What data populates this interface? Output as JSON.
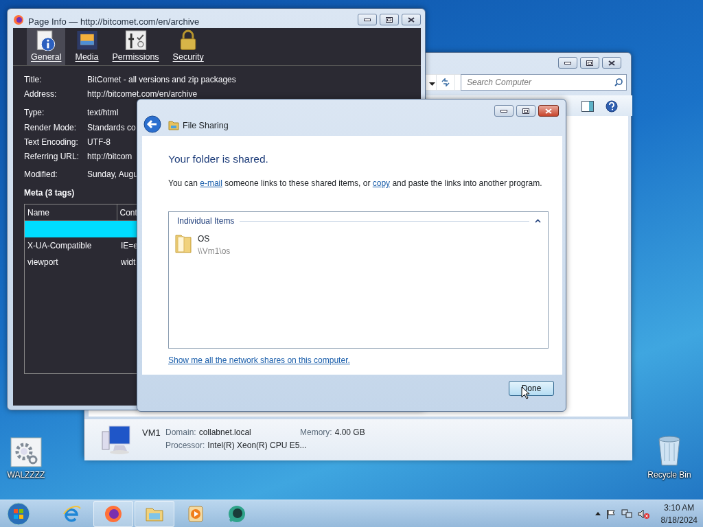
{
  "desktop_icons": [
    {
      "kind": "settings",
      "label": "WALZZZZ"
    },
    {
      "kind": "recycle",
      "label": "Recycle Bin"
    }
  ],
  "explorer_window": {
    "search": {
      "placeholder": "Search Computer"
    },
    "details": {
      "name": "VM1",
      "fields": [
        {
          "label": "Domain:",
          "value": "collabnet.local"
        },
        {
          "label": "Memory:",
          "value": "4.00 GB"
        },
        {
          "label": "Processor:",
          "value": "Intel(R) Xeon(R) CPU E5..."
        }
      ]
    }
  },
  "page_info_window": {
    "title": "Page Info — http://bitcomet.com/en/archive",
    "tabs": [
      {
        "kind": "general",
        "label": "General",
        "selected": true
      },
      {
        "kind": "media",
        "label": "Media",
        "selected": false
      },
      {
        "kind": "permissions",
        "label": "Permissions",
        "selected": false
      },
      {
        "kind": "security",
        "label": "Security",
        "selected": false
      }
    ],
    "fields": [
      {
        "label": "Title:",
        "value": "BitComet - all versions and zip packages"
      },
      {
        "label": "Address:",
        "value": "http://bitcomet.com/en/archive"
      },
      {
        "label": "Type:",
        "value": "text/html"
      },
      {
        "label": "Render Mode:",
        "value": "Standards co"
      },
      {
        "label": "Text Encoding:",
        "value": "UTF-8"
      },
      {
        "label": "Referring URL:",
        "value": "http://bitcom"
      },
      {
        "label": "Modified:",
        "value": "Sunday, Augu"
      }
    ],
    "meta_heading": "Meta (3 tags)",
    "meta_table": {
      "columns": [
        "Name",
        "Cont"
      ],
      "rows": [
        {
          "name": "",
          "content": "",
          "selected": true
        },
        {
          "name": "X-UA-Compatible",
          "content": "IE=e",
          "selected": false
        },
        {
          "name": "viewport",
          "content": "widt",
          "selected": false
        }
      ]
    }
  },
  "file_sharing_dialog": {
    "title": "File Sharing",
    "heading": "Your folder is shared.",
    "message": [
      {
        "kind": "text",
        "text": "You can "
      },
      {
        "kind": "link",
        "text": "e-mail"
      },
      {
        "kind": "text",
        "text": " someone links to these shared items, or "
      },
      {
        "kind": "link",
        "text": "copy"
      },
      {
        "kind": "text",
        "text": " and paste the links into another program."
      }
    ],
    "group": {
      "label": "Individual Items",
      "expanded": true,
      "items": [
        {
          "name": "OS",
          "path": "\\\\Vm1\\os"
        }
      ]
    },
    "shares_link": "Show me all the network shares on this computer.",
    "button": "Done"
  },
  "taskbar": {
    "apps": [
      {
        "kind": "ie",
        "running": false
      },
      {
        "kind": "firefox",
        "running": true
      },
      {
        "kind": "explorer",
        "running": true
      },
      {
        "kind": "media",
        "running": false
      },
      {
        "kind": "chat",
        "running": false
      }
    ],
    "time": "3:10 AM",
    "date": "8/18/2024"
  }
}
